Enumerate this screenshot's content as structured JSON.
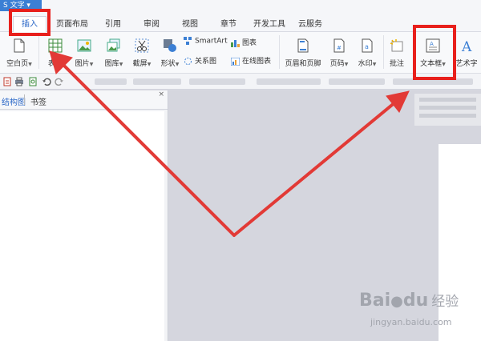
{
  "window": {
    "app_button": "S 文字 ▾"
  },
  "tabs": [
    "插入",
    "页面布局",
    "引用",
    "审阅",
    "视图",
    "章节",
    "开发工具",
    "云服务"
  ],
  "ribbon": {
    "blank_page": "空白页",
    "table": "表格",
    "picture": "图片",
    "gallery": "图库",
    "screenshot": "截屏",
    "shapes": "形状",
    "smartart": "SmartArt",
    "chart": "图表",
    "relation": "关系图",
    "online_chart": "在线图表",
    "header_footer": "页眉和页脚",
    "page_number": "页码",
    "watermark": "水印",
    "comment": "批注",
    "textbox": "文本框",
    "wordart": "艺术字"
  },
  "nav": {
    "tab_structure": "结构图",
    "tab_bookmark": "书签",
    "close": "×"
  },
  "watermark": {
    "logo": "Bai",
    "logo_tail": "du",
    "cn": "经验",
    "url": "jingyan.baidu.com"
  },
  "colors": {
    "annotation": "#e8201c",
    "accent": "#2a67c7",
    "app_blue": "#3b7fd4"
  }
}
